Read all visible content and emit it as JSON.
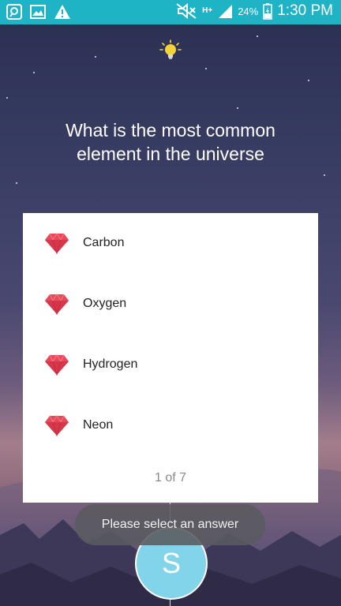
{
  "status_bar": {
    "battery_percent": "24%",
    "time": "1:30 PM",
    "network": "H+",
    "icons": [
      "circle-app-icon",
      "image-icon",
      "warning-icon",
      "mute-icon",
      "signal-icon",
      "battery-charging-icon"
    ]
  },
  "quiz": {
    "question": "What is the most common element in the universe",
    "options": [
      {
        "label": "Carbon",
        "icon": "gem-icon"
      },
      {
        "label": "Oxygen",
        "icon": "gem-icon"
      },
      {
        "label": "Hydrogen",
        "icon": "gem-icon"
      },
      {
        "label": "Neon",
        "icon": "gem-icon"
      }
    ],
    "pager": "1 of 7",
    "hint_icon": "lightbulb-icon"
  },
  "toast": {
    "message": "Please select an answer"
  },
  "avatar": {
    "initial": "S",
    "color": "#82d4ea"
  },
  "colors": {
    "status_bar": "#1fb3c6",
    "gem": "#e8485a"
  }
}
